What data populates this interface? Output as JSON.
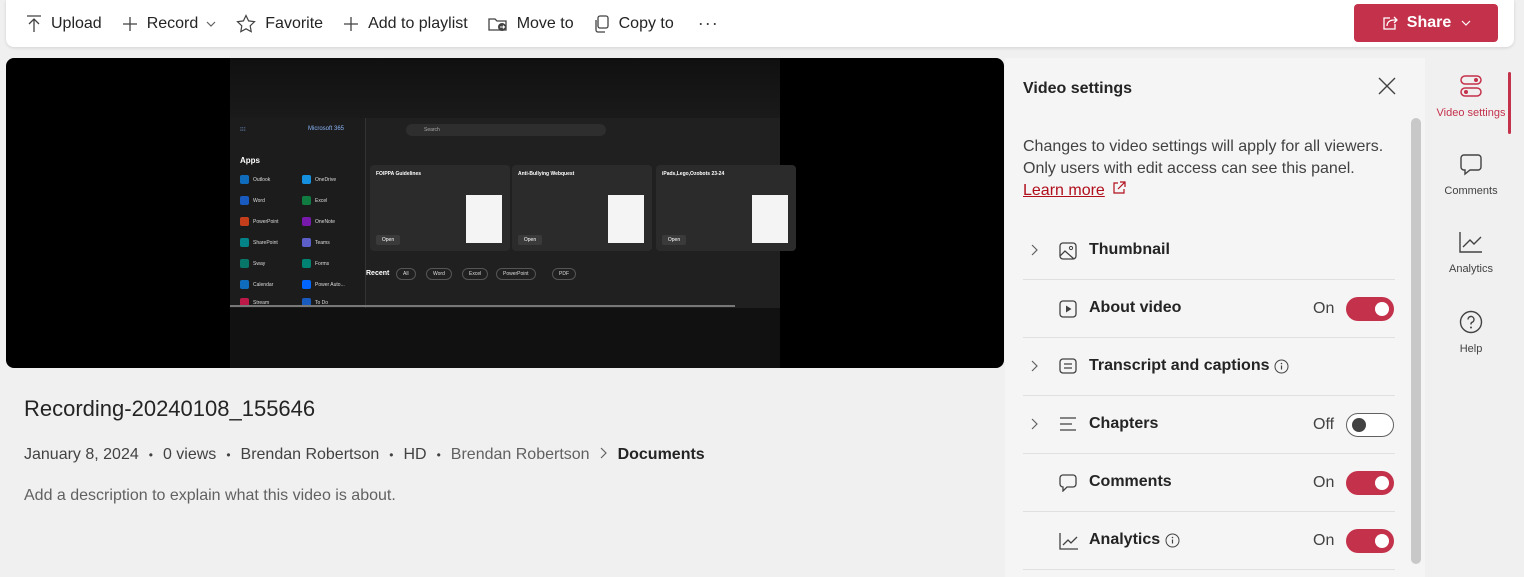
{
  "toolbar": {
    "upload": "Upload",
    "record": "Record",
    "favorite": "Favorite",
    "add_to_playlist": "Add to playlist",
    "move_to": "Move to",
    "copy_to": "Copy to",
    "more": "···",
    "share": "Share"
  },
  "video": {
    "m365_label": "Microsoft 365",
    "search": "Search",
    "apps_title": "Apps",
    "apps": [
      "Outlook",
      "OneDrive",
      "Word",
      "Excel",
      "PowerPoint",
      "OneNote",
      "SharePoint",
      "Teams",
      "Sway",
      "Forms",
      "Calendar",
      "Power Auto...",
      "Stream",
      "To Do"
    ],
    "cards": [
      "FOIPPA Guidelines",
      "Anti-Bullying Webquest",
      "iPads,Lego,Ozobots 23-24"
    ],
    "card_button": "Open",
    "recent": "Recent",
    "chips": [
      "All",
      "Word",
      "Excel",
      "PowerPoint",
      "PDF"
    ]
  },
  "info": {
    "title": "Recording-20240108_155646",
    "date": "January 8, 2024",
    "views": "0 views",
    "author": "Brendan Robertson",
    "quality": "HD",
    "crumb_root": "Brendan Robertson",
    "crumb_current": "Documents",
    "description_placeholder": "Add a description to explain what this video is about."
  },
  "panel": {
    "title": "Video settings",
    "note": "Changes to video settings will apply for all viewers. Only users with edit access can see this panel.",
    "learn_more": "Learn more",
    "rows": [
      {
        "label": "Thumbnail",
        "state": "",
        "toggle": null
      },
      {
        "label": "About video",
        "state": "On",
        "toggle": "on"
      },
      {
        "label": "Transcript and captions",
        "state": "",
        "toggle": null
      },
      {
        "label": "Chapters",
        "state": "Off",
        "toggle": "off"
      },
      {
        "label": "Comments",
        "state": "On",
        "toggle": "on"
      },
      {
        "label": "Analytics",
        "state": "On",
        "toggle": "on"
      }
    ]
  },
  "rail": {
    "video_settings": "Video settings",
    "comments": "Comments",
    "analytics": "Analytics",
    "help": "Help"
  },
  "colors": {
    "accent": "#c4314b"
  }
}
